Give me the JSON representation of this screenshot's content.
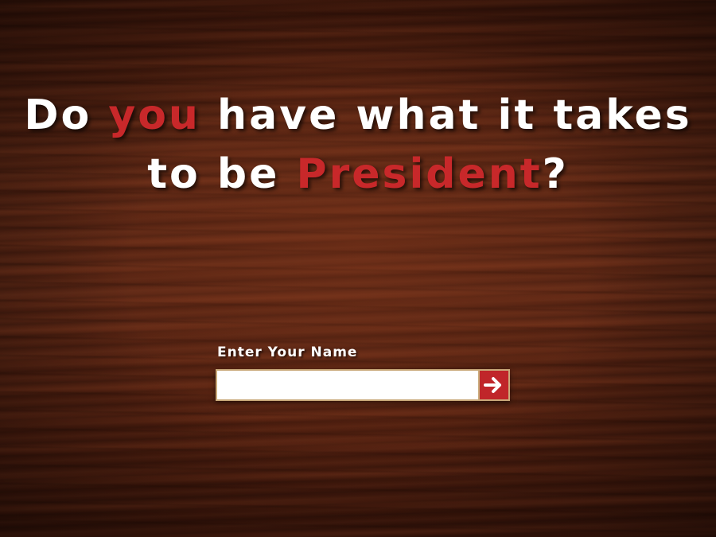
{
  "headline": {
    "line1_part1": "Do ",
    "line1_highlight": "you",
    "line1_part2": " have what it takes",
    "line2_part1": "to be ",
    "line2_highlight": "President",
    "line2_part2": "?"
  },
  "form": {
    "label": "Enter Your Name",
    "input_value": "",
    "submit_icon": "arrow-right-icon"
  },
  "colors": {
    "highlight": "#c8282a",
    "button": "#c0262a",
    "text": "#ffffff",
    "background": "#4a1e10"
  }
}
